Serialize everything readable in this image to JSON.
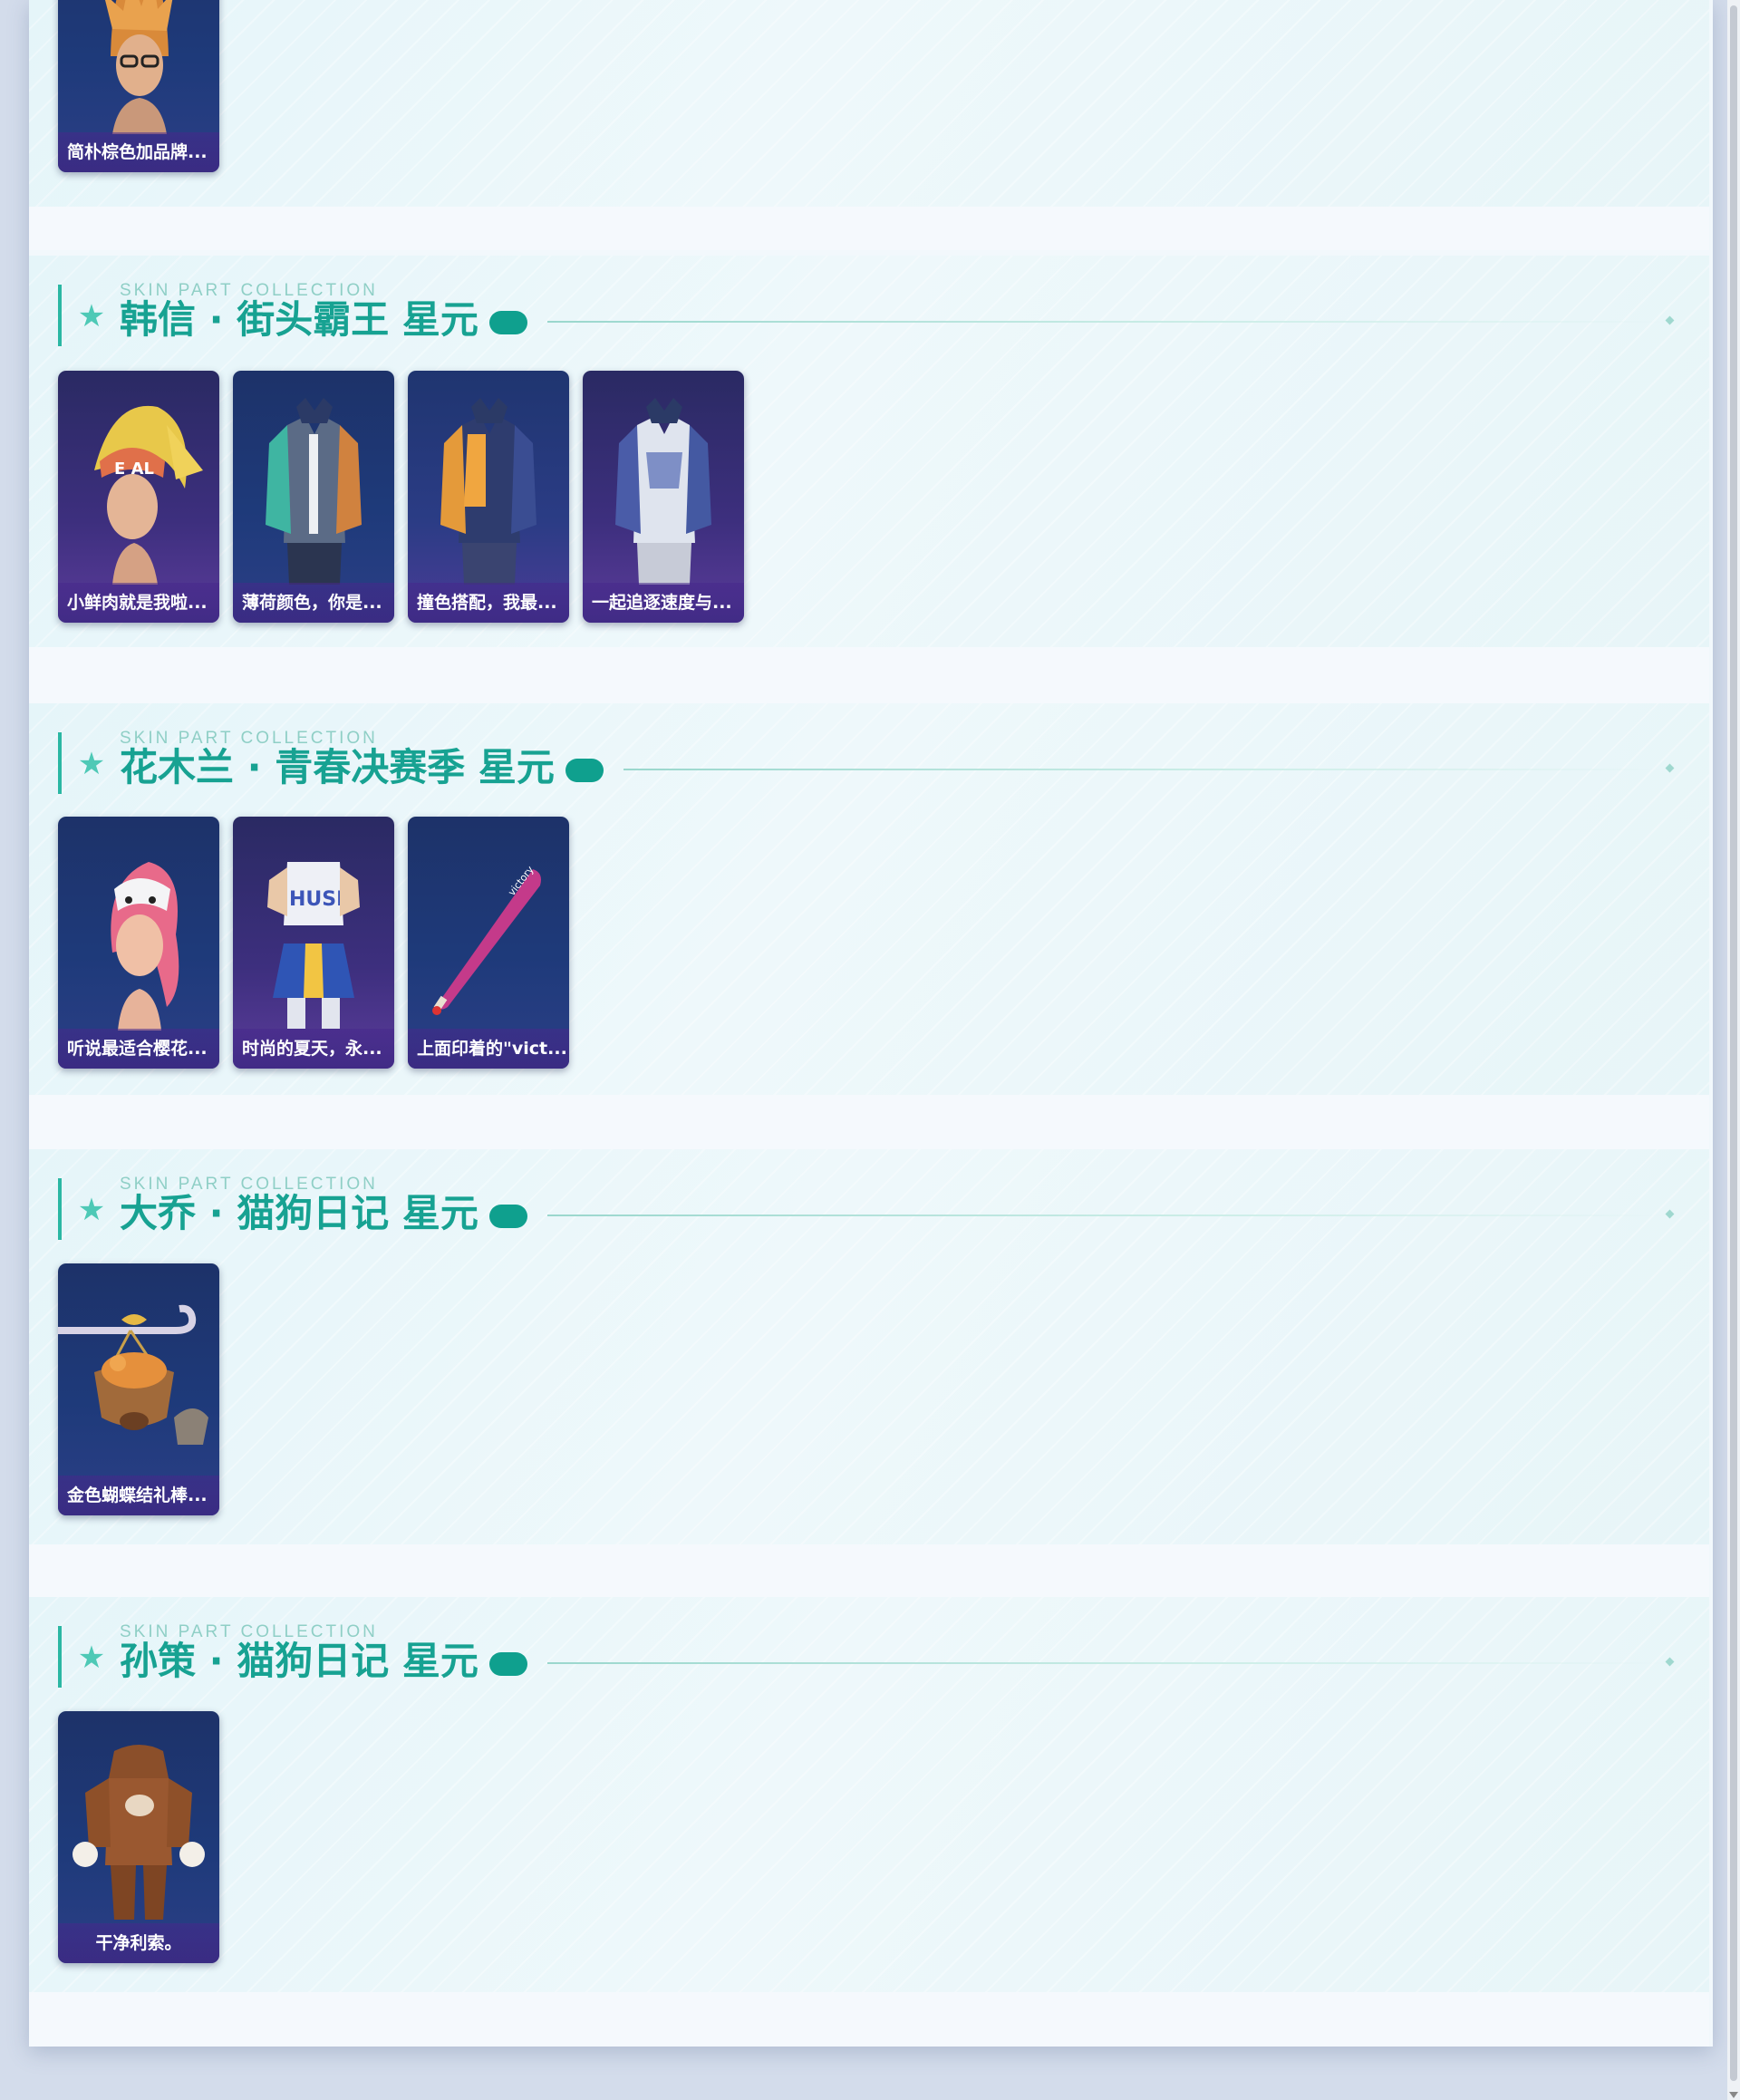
{
  "top_section": {
    "cards": [
      {
        "label": "简朴棕色加品牌...",
        "icon": "hero-head-orange-hair"
      }
    ]
  },
  "sections": [
    {
      "subtitle": "SKIN PART COLLECTION",
      "title": "韩信 · 街头霸王 星元",
      "cards": [
        {
          "label": "小鲜肉就是我啦...",
          "icon": "hero-head-blonde-cap"
        },
        {
          "label": "薄荷颜色，你是...",
          "icon": "jacket-mint"
        },
        {
          "label": "撞色搭配，我最...",
          "icon": "jacket-orange"
        },
        {
          "label": "一起追逐速度与...",
          "icon": "jacket-white"
        }
      ]
    },
    {
      "subtitle": "SKIN PART COLLECTION",
      "title": "花木兰 · 青春决赛季 星元",
      "cards": [
        {
          "label": "听说最适合樱花...",
          "icon": "hero-head-pink-hair"
        },
        {
          "label": "时尚的夏天，永...",
          "icon": "cheer-outfit"
        },
        {
          "label": "上面印着的\"vict...",
          "icon": "baseball-bat"
        }
      ]
    },
    {
      "subtitle": "SKIN PART COLLECTION",
      "title": "大乔 · 猫狗日记 星元",
      "cards": [
        {
          "label": "金色蝴蝶结礼棒...",
          "icon": "cat-basket-staff"
        }
      ]
    },
    {
      "subtitle": "SKIN PART COLLECTION",
      "title": "孙策 · 猫狗日记 星元",
      "cards": [
        {
          "label": "干净利索。",
          "icon": "brown-hoodie"
        }
      ]
    }
  ],
  "colors": {
    "accent": "#17a292",
    "pill": "#0fa08e",
    "card_bg": "#1e3a7a"
  }
}
